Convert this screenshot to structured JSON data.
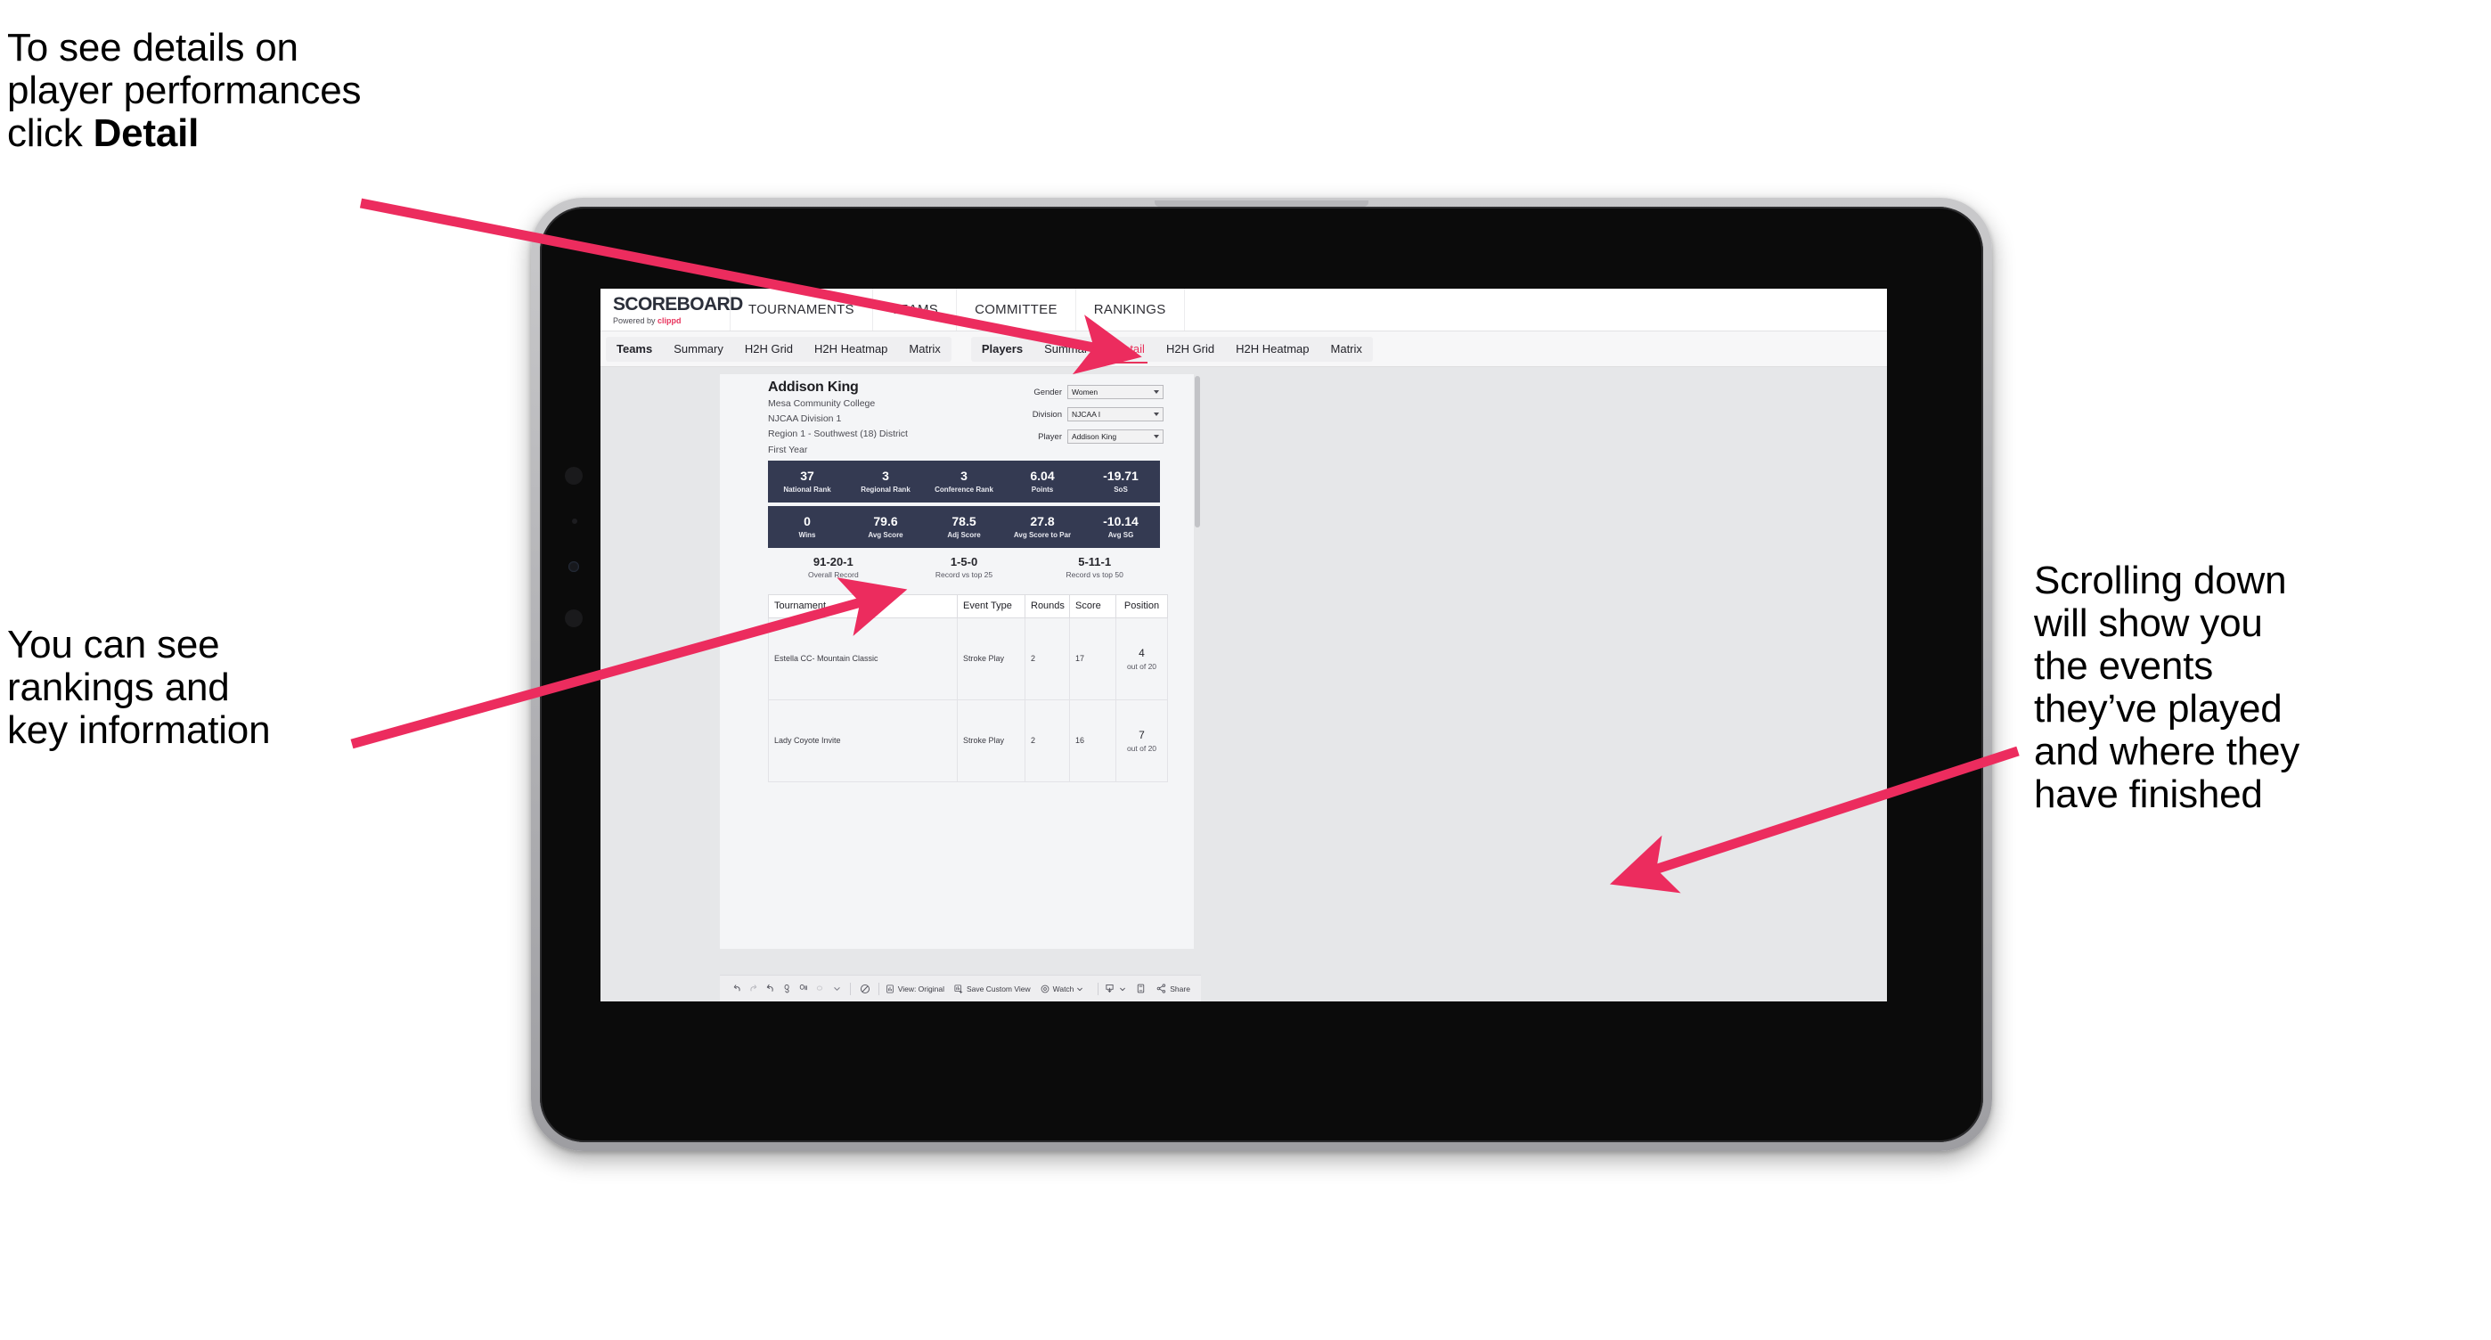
{
  "annotations": {
    "top_left": "To see details on\nplayer performances\nclick ",
    "top_left_bold": "Detail",
    "left": "You can see\nrankings and\nkey information",
    "right": "Scrolling down\nwill show you\nthe events\nthey’ve played\nand where they\nhave finished"
  },
  "colors": {
    "accent_pink": "#e8335c",
    "stat_navy": "#343a52",
    "page_bg": "#e6e7e9"
  },
  "app": {
    "brand": {
      "title": "SCOREBOARD",
      "powered_prefix": "Powered by ",
      "powered_name": "clippd"
    },
    "topnav": [
      "TOURNAMENTS",
      "TEAMS",
      "COMMITTEE",
      "RANKINGS"
    ],
    "subnav": {
      "teams_group": {
        "head": "Teams",
        "items": [
          "Summary",
          "H2H Grid",
          "H2H Heatmap",
          "Matrix"
        ]
      },
      "players_group": {
        "head": "Players",
        "items": [
          "Summary",
          "Detail",
          "H2H Grid",
          "H2H Heatmap",
          "Matrix"
        ],
        "active": "Detail"
      }
    }
  },
  "player": {
    "name": "Addison King",
    "school": "Mesa Community College",
    "division": "NJCAA Division 1",
    "region": "Region 1 - Southwest (18) District",
    "year": "First Year"
  },
  "filters": [
    {
      "label": "Gender",
      "value": "Women"
    },
    {
      "label": "Division",
      "value": "NJCAA I"
    },
    {
      "label": "Player",
      "value": "Addison King"
    }
  ],
  "stats_row_1": [
    {
      "value": "37",
      "label": "National Rank"
    },
    {
      "value": "3",
      "label": "Regional Rank"
    },
    {
      "value": "3",
      "label": "Conference Rank"
    },
    {
      "value": "6.04",
      "label": "Points"
    },
    {
      "value": "-19.71",
      "label": "SoS"
    }
  ],
  "stats_row_2": [
    {
      "value": "0",
      "label": "Wins"
    },
    {
      "value": "79.6",
      "label": "Avg Score"
    },
    {
      "value": "78.5",
      "label": "Adj Score"
    },
    {
      "value": "27.8",
      "label": "Avg Score to Par"
    },
    {
      "value": "-10.14",
      "label": "Avg SG"
    }
  ],
  "records": [
    {
      "value": "91-20-1",
      "label": "Overall Record"
    },
    {
      "value": "1-5-0",
      "label": "Record vs top 25"
    },
    {
      "value": "5-11-1",
      "label": "Record vs top 50"
    }
  ],
  "events_table": {
    "headers": [
      "Tournament",
      "Event Type",
      "Rounds",
      "Score",
      "Position"
    ],
    "rows": [
      {
        "tournament": "Estella CC- Mountain Classic",
        "event_type": "Stroke Play",
        "rounds": "2",
        "score": "17",
        "position": "4",
        "position_of": "out of 20"
      },
      {
        "tournament": "Lady Coyote Invite",
        "event_type": "Stroke Play",
        "rounds": "2",
        "score": "16",
        "position": "7",
        "position_of": "out of 20"
      }
    ]
  },
  "toolbar": {
    "view_original": "View: Original",
    "save_custom_view": "Save Custom View",
    "watch": "Watch",
    "share": "Share"
  }
}
